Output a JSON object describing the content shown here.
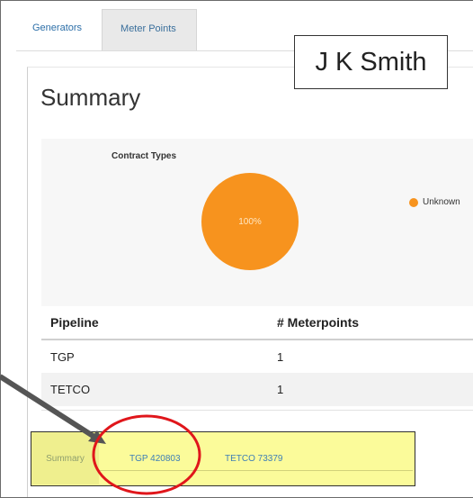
{
  "top_tabs": [
    {
      "label": "Generators",
      "active": false
    },
    {
      "label": "Meter Points",
      "active": true
    }
  ],
  "overlay_name": "J K Smith",
  "page_title": "Summary",
  "chart_data": {
    "type": "pie",
    "title": "Contract Types",
    "slices": [
      {
        "label": "Unknown",
        "value": 100,
        "display": "100%",
        "color": "#f7931e"
      }
    ],
    "legend_position": "top-right"
  },
  "table": {
    "headers": [
      "Pipeline",
      "# Meterpoints"
    ],
    "rows": [
      [
        "TGP",
        "1"
      ],
      [
        "TETCO",
        "1"
      ]
    ]
  },
  "bottom_tabs": [
    {
      "label": "Summary",
      "active": true
    },
    {
      "label": "TGP 420803",
      "active": false
    },
    {
      "label": "TETCO 73379",
      "active": false
    }
  ],
  "colors": {
    "accent_link": "#2d6fa8",
    "pie_unknown": "#f7931e",
    "highlight_yellow": "#fbfb9a",
    "annotation_red": "#e0161b"
  }
}
